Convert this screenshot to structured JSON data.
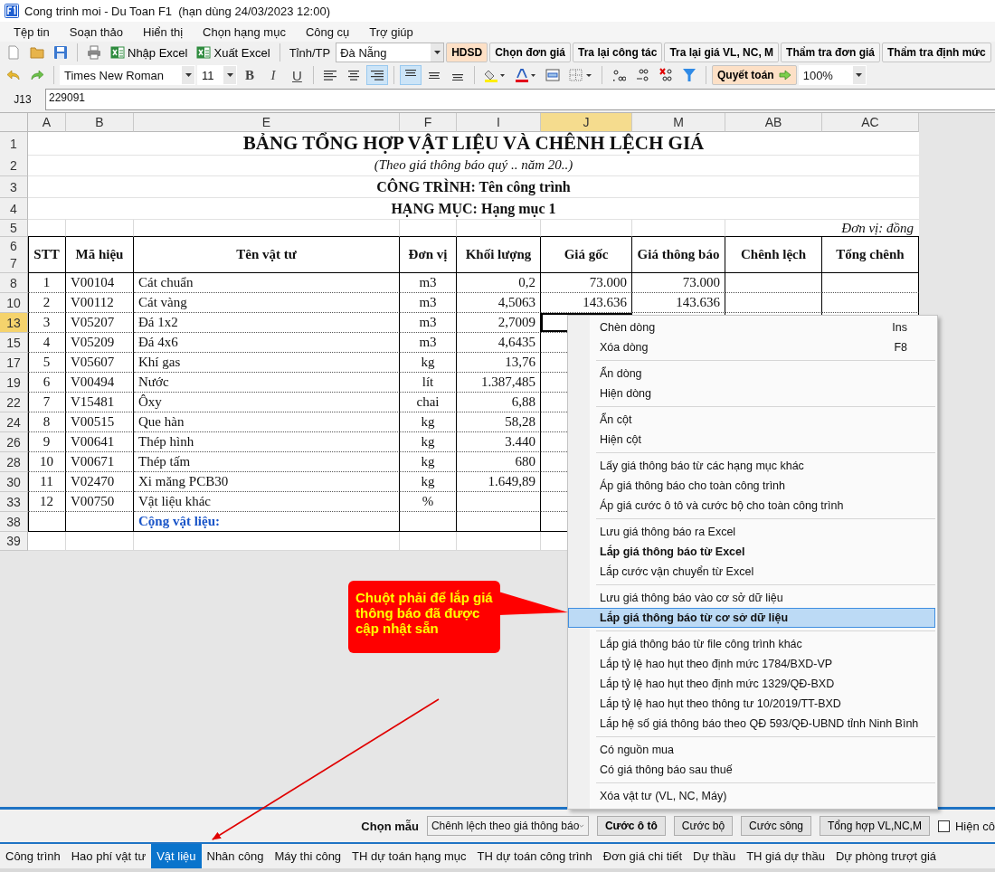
{
  "window": {
    "title": "Cong trinh moi - Du Toan F1  (hạn dùng 24/03/2023 12:00)"
  },
  "menu": [
    "Tệp tin",
    "Soạn thảo",
    "Hiển thị",
    "Chọn hạng mục",
    "Công cụ",
    "Trợ giúp"
  ],
  "toolbar": {
    "import_button": "Nhập Excel",
    "export_button": "Xuất Excel",
    "province_label": "Tỉnh/TP",
    "province": "Đà Nẵng",
    "buttons": [
      {
        "label": "HDSD",
        "kind": "accent"
      },
      {
        "label": "Chọn đơn giá",
        "kind": "plain"
      },
      {
        "label": "Tra lại công tác",
        "kind": "plain"
      },
      {
        "label": "Tra lại giá VL, NC, M",
        "kind": "plain"
      },
      {
        "label": "Thẩm tra đơn giá",
        "kind": "plain"
      },
      {
        "label": "Thẩm tra định mức",
        "kind": "plain"
      }
    ]
  },
  "format_bar": {
    "font": "Times New Roman",
    "size": "11",
    "style_buttons": [
      {
        "label": "B",
        "selected": false
      },
      {
        "label": "I",
        "selected": false
      },
      {
        "label": "U",
        "selected": false
      }
    ],
    "align": [
      {
        "selected": false
      },
      {
        "selected": false
      },
      {
        "selected": true
      }
    ],
    "valign": [
      {
        "selected": true
      },
      {
        "selected": false
      },
      {
        "selected": false
      }
    ],
    "settle_button": "Quyết toán",
    "zoom": "100%"
  },
  "formula_bar": {
    "cell": "J13",
    "value": "229091"
  },
  "sheet": {
    "columns": [
      {
        "label": "A",
        "selected": false
      },
      {
        "label": "B",
        "selected": false
      },
      {
        "label": "E",
        "selected": false
      },
      {
        "label": "F",
        "selected": false
      },
      {
        "label": "I",
        "selected": false
      },
      {
        "label": "J",
        "selected": true
      },
      {
        "label": "M",
        "selected": false
      },
      {
        "label": "AB",
        "selected": false
      },
      {
        "label": "AC",
        "selected": false
      }
    ],
    "title_rows": [
      {
        "row": "1",
        "kind": "title",
        "text": "BẢNG TỔNG HỢP VẬT LIỆU VÀ CHÊNH LỆCH GIÁ"
      },
      {
        "row": "2",
        "kind": "subtitle",
        "text": "(Theo giá thông báo quý .. năm 20..)"
      },
      {
        "row": "3",
        "kind": "heading",
        "text": "CÔNG TRÌNH: Tên công trình"
      },
      {
        "row": "4",
        "kind": "heading",
        "text": "HẠNG MỤC: Hạng mục 1"
      },
      {
        "row": "5",
        "kind": "unit",
        "text": "Đơn vị: đồng"
      }
    ],
    "header": {
      "rows": [
        "6",
        "7"
      ],
      "cells": [
        "STT",
        "Mã hiệu",
        "Tên vật tư",
        "Đơn vị",
        "Khối lượng",
        "Giá gốc",
        "Giá thông báo",
        "Chênh lệch",
        "Tổng chênh"
      ]
    },
    "rows": [
      {
        "row": "8",
        "kind": "item",
        "selected": false,
        "stt": "1",
        "code": "V00104",
        "name": "Cát chuẩn",
        "unit": "m3",
        "qty": "0,2",
        "base_price": "73.000",
        "notice_price": "73.000"
      },
      {
        "row": "10",
        "kind": "item",
        "selected": false,
        "stt": "2",
        "code": "V00112",
        "name": "Cát vàng",
        "unit": "m3",
        "qty": "4,5063",
        "base_price": "143.636",
        "notice_price": "143.636"
      },
      {
        "row": "13",
        "kind": "item",
        "selected": true,
        "stt": "3",
        "code": "V05207",
        "name": "Đá 1x2",
        "unit": "m3",
        "qty": "2,7009"
      },
      {
        "row": "15",
        "kind": "item",
        "selected": false,
        "stt": "4",
        "code": "V05209",
        "name": "Đá 4x6",
        "unit": "m3",
        "qty": "4,6435"
      },
      {
        "row": "17",
        "kind": "item",
        "selected": false,
        "stt": "5",
        "code": "V05607",
        "name": "Khí gas",
        "unit": "kg",
        "qty": "13,76"
      },
      {
        "row": "19",
        "kind": "item",
        "selected": false,
        "stt": "6",
        "code": "V00494",
        "name": "Nước",
        "unit": "lít",
        "qty": "1.387,485"
      },
      {
        "row": "22",
        "kind": "item",
        "selected": false,
        "stt": "7",
        "code": "V15481",
        "name": "Ôxy",
        "unit": "chai",
        "qty": "6,88"
      },
      {
        "row": "24",
        "kind": "item",
        "selected": false,
        "stt": "8",
        "code": "V00515",
        "name": "Que hàn",
        "unit": "kg",
        "qty": "58,28"
      },
      {
        "row": "26",
        "kind": "item",
        "selected": false,
        "stt": "9",
        "code": "V00641",
        "name": "Thép hình",
        "unit": "kg",
        "qty": "3.440"
      },
      {
        "row": "28",
        "kind": "item",
        "selected": false,
        "stt": "10",
        "code": "V00671",
        "name": "Thép tấm",
        "unit": "kg",
        "qty": "680"
      },
      {
        "row": "30",
        "kind": "item",
        "selected": false,
        "stt": "11",
        "code": "V02470",
        "name": "Xi măng PCB30",
        "unit": "kg",
        "qty": "1.649,89"
      },
      {
        "row": "33",
        "kind": "item",
        "selected": false,
        "stt": "12",
        "code": "V00750",
        "name": "Vật liệu khác",
        "unit": "%"
      },
      {
        "row": "38",
        "kind": "total",
        "selected": false,
        "name": "Cộng vật liệu:"
      },
      {
        "row": "39",
        "kind": "blank",
        "selected": false
      }
    ]
  },
  "context_menu": [
    [
      {
        "label": "Chèn dòng",
        "shortcut": "Ins",
        "bold": false,
        "selected": false
      },
      {
        "label": "Xóa dòng",
        "shortcut": "F8",
        "bold": false,
        "selected": false
      }
    ],
    [
      {
        "label": "Ẩn dòng",
        "bold": false,
        "selected": false
      },
      {
        "label": "Hiện dòng",
        "bold": false,
        "selected": false
      }
    ],
    [
      {
        "label": "Ẩn cột",
        "bold": false,
        "selected": false
      },
      {
        "label": "Hiện cột",
        "bold": false,
        "selected": false
      }
    ],
    [
      {
        "label": "Lấy giá thông báo từ các hạng mục khác",
        "bold": false,
        "selected": false
      },
      {
        "label": "Áp giá thông báo cho toàn công trình",
        "bold": false,
        "selected": false
      },
      {
        "label": "Áp giá cước ô tô và cước bộ cho toàn công trình",
        "bold": false,
        "selected": false
      }
    ],
    [
      {
        "label": "Lưu giá thông báo ra Excel",
        "bold": false,
        "selected": false
      },
      {
        "label": "Lắp giá thông báo từ Excel",
        "bold": true,
        "selected": false
      },
      {
        "label": "Lắp cước vận chuyển từ Excel",
        "bold": false,
        "selected": false
      }
    ],
    [
      {
        "label": "Lưu giá thông báo vào cơ sở dữ liệu",
        "bold": false,
        "selected": false
      },
      {
        "label": "Lắp giá thông báo từ cơ sở dữ liệu",
        "bold": true,
        "selected": true
      }
    ],
    [
      {
        "label": "Lắp giá thông báo từ file công trình khác",
        "bold": false,
        "selected": false
      },
      {
        "label": "Lắp tỷ lệ hao hụt theo định mức 1784/BXD-VP",
        "bold": false,
        "selected": false
      },
      {
        "label": "Lắp tỷ lệ hao hụt theo định mức 1329/QĐ-BXD",
        "bold": false,
        "selected": false
      },
      {
        "label": "Lắp tỷ lệ hao hụt theo thông tư 10/2019/TT-BXD",
        "bold": false,
        "selected": false
      },
      {
        "label": "Lắp hệ số giá thông báo theo QĐ 593/QĐ-UBND tỉnh Ninh Bình",
        "bold": false,
        "selected": false
      }
    ],
    [
      {
        "label": "Có nguồn mua",
        "bold": false,
        "selected": false
      },
      {
        "label": "Có giá thông báo sau thuế",
        "bold": false,
        "selected": false
      }
    ],
    [
      {
        "label": "Xóa vật tư (VL, NC, Máy)",
        "bold": false,
        "selected": false
      }
    ]
  ],
  "callout": "Chuột phải để lắp giá thông báo đã được cập nhật sẵn",
  "bottom_bar": {
    "template_label": "Chọn mẫu",
    "template": "Chênh lệch theo giá thông báo",
    "buttons": [
      {
        "label": "Cước ô tô",
        "bold": true
      },
      {
        "label": "Cước bộ",
        "bold": false
      },
      {
        "label": "Cước sông",
        "bold": false
      },
      {
        "label": "Tổng hợp VL,NC,M",
        "bold": false
      }
    ],
    "checkbox": {
      "label": "Hiện cô",
      "checked": false
    }
  },
  "tabs": [
    {
      "label": "Công trình",
      "selected": false
    },
    {
      "label": "Hao phí vật tư",
      "selected": false
    },
    {
      "label": "Vật liệu",
      "selected": true
    },
    {
      "label": "Nhân công",
      "selected": false
    },
    {
      "label": "Máy thi công",
      "selected": false
    },
    {
      "label": "TH dự toán hạng mục",
      "selected": false
    },
    {
      "label": "TH dự toán công trình",
      "selected": false
    },
    {
      "label": "Đơn giá chi tiết",
      "selected": false
    },
    {
      "label": "Dự thầu",
      "selected": false
    },
    {
      "label": "TH giá dự thầu",
      "selected": false
    },
    {
      "label": "Dự phòng trượt giá",
      "selected": false
    }
  ]
}
